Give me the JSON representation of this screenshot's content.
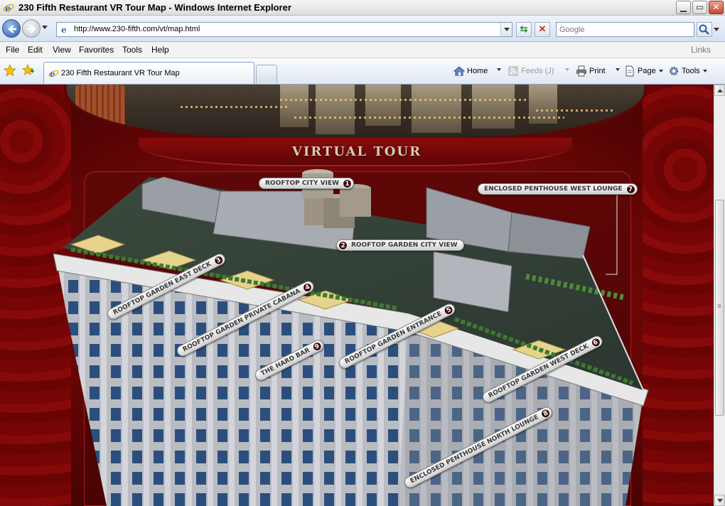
{
  "window": {
    "title": "230 Fifth Restaurant VR Tour Map - Windows Internet Explorer",
    "controls": [
      "minimize-button",
      "maximize-button",
      "close-button"
    ]
  },
  "address_bar": {
    "url": "http://www.230-fifth.com/vt/map.html",
    "search_placeholder": "Google"
  },
  "menu": {
    "items": [
      "File",
      "Edit",
      "View",
      "Favorites",
      "Tools",
      "Help"
    ],
    "links_label": "Links"
  },
  "tabs": {
    "active_label": "230 Fifth Restaurant VR Tour Map"
  },
  "command_bar": {
    "home": "Home",
    "feeds": "Feeds (J)",
    "print": "Print",
    "page": "Page",
    "tools": "Tools"
  },
  "page": {
    "heading": "VIRTUAL TOUR",
    "locations": [
      {
        "num": "1",
        "label": "ROOFTOP CITY VIEW"
      },
      {
        "num": "2",
        "label": "ROOFTOP GARDEN CITY VIEW"
      },
      {
        "num": "3",
        "label": "ROOFTOP GARDEN EAST DECK"
      },
      {
        "num": "4",
        "label": "ROOFTOP GARDEN PRIVATE CABANA"
      },
      {
        "num": "5",
        "label": "ROOFTOP GARDEN ENTRANCE"
      },
      {
        "num": "6",
        "label": "ROOFTOP GARDEN WEST DECK"
      },
      {
        "num": "7",
        "label": "ENCLOSED PENTHOUSE WEST LOUNGE"
      },
      {
        "num": "8",
        "label": "ENCLOSED PENTHOUSE NORTH LOUNGE"
      },
      {
        "num": "9",
        "label": "THE HARD BAR"
      }
    ]
  },
  "colors": {
    "page_red": "#6a0606",
    "ie_blue": "#2c5aa8",
    "tag_bg": "#e8e8e8"
  }
}
